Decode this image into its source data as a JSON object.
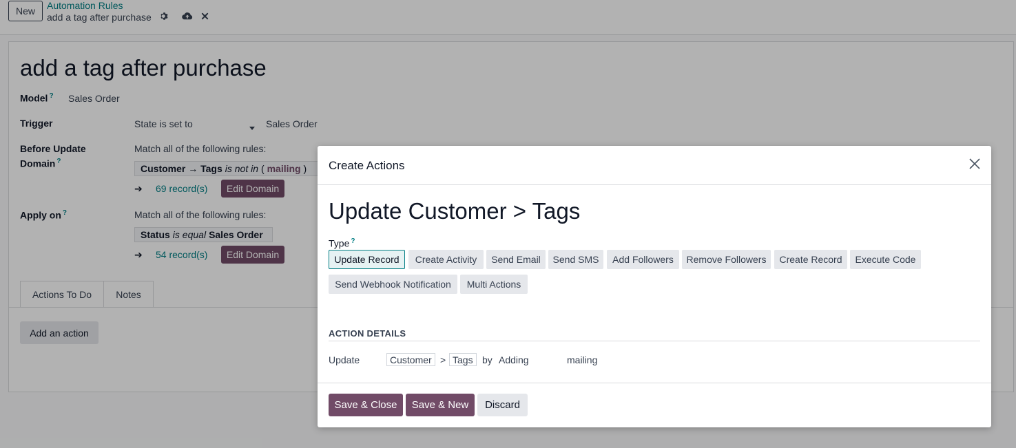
{
  "topbar": {
    "new_label": "New",
    "breadcrumb_link": "Automation Rules",
    "breadcrumb_current": "add a tag after purchase"
  },
  "form": {
    "title": "add a tag after purchase",
    "model_label": "Model",
    "model_value": "Sales Order",
    "trigger_label": "Trigger",
    "trigger_value": "State is set to",
    "trigger_target": "Sales Order",
    "before_update_label_1": "Before Update",
    "before_update_label_2": "Domain",
    "match_rules_text": "Match all of the following rules:",
    "before_domain": {
      "field": "Customer → Tags",
      "operator": "is not in",
      "open": "(",
      "tag": "mailing",
      "close": ")"
    },
    "before_records": "69 record(s)",
    "edit_domain": "Edit Domain",
    "apply_on_label": "Apply on",
    "apply_domain": {
      "field": "Status",
      "operator": "is equal",
      "value": "Sales Order"
    },
    "apply_records": "54 record(s)",
    "arrow": "➔",
    "help_mark": "?"
  },
  "tabs": [
    {
      "label": "Actions To Do",
      "active": true
    },
    {
      "label": "Notes",
      "active": false
    }
  ],
  "add_action_label": "Add an action",
  "modal": {
    "title": "Create Actions",
    "heading": "Update Customer > Tags",
    "type_label": "Type",
    "help_mark": "?",
    "type_buttons": [
      "Update Record",
      "Create Activity",
      "Send Email",
      "Send SMS",
      "Add Followers",
      "Remove Followers",
      "Create Record",
      "Execute Code",
      "Send Webhook Notification",
      "Multi Actions"
    ],
    "active_type": "Update Record",
    "action_details_title": "ACTION DETAILS",
    "details": {
      "update": "Update",
      "field1": "Customer",
      "sep": ">",
      "field2": "Tags",
      "by": "by",
      "mode": "Adding",
      "value": "mailing"
    },
    "footer": {
      "save_close": "Save & Close",
      "save_new": "Save & New",
      "discard": "Discard"
    }
  },
  "colors": {
    "brand": "#714b67",
    "accent": "#017e84"
  }
}
